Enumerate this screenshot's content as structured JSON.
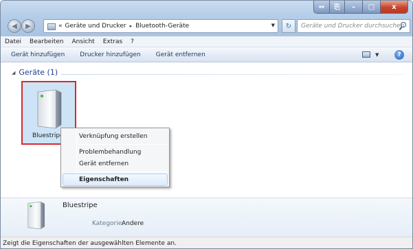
{
  "window": {
    "buttons": {
      "extra_1": "↔",
      "extra_2": "⎘",
      "minimize": "–",
      "maximize": "□",
      "close": "x"
    }
  },
  "nav": {
    "back_glyph": "◀",
    "forward_glyph": "▶",
    "recent_glyph": "▼",
    "address_prefix": "«",
    "breadcrumbs": [
      "Geräte und Drucker",
      "Bluetooth-Geräte"
    ],
    "breadcrumb_separator": "▸",
    "address_drop_glyph": "▼",
    "refresh_glyph": "↻",
    "search_placeholder": "Geräte und Drucker durchsuchen"
  },
  "menubar": {
    "items": [
      "Datei",
      "Bearbeiten",
      "Ansicht",
      "Extras",
      "?"
    ]
  },
  "commandbar": {
    "items": [
      "Gerät hinzufügen",
      "Drucker hinzufügen",
      "Gerät entfernen"
    ],
    "view_drop_glyph": "▼",
    "help_glyph": "?"
  },
  "content": {
    "group_toggle_glyph": "◢",
    "group_label": "Geräte (1)",
    "device": {
      "name": "Bluestripe"
    }
  },
  "context_menu": {
    "items": [
      {
        "label": "Verknüpfung erstellen"
      },
      {
        "label": "Problembehandlung"
      },
      {
        "label": "Gerät entfernen"
      },
      {
        "label": "Eigenschaften",
        "bold": true,
        "highlighted": true
      }
    ]
  },
  "details": {
    "name": "Bluestripe",
    "category_label": "Kategorie:",
    "category_value": "Andere"
  },
  "statusbar": {
    "text": "Zeigt die Eigenschaften der ausgewählten Elemente an."
  },
  "colors": {
    "accent_link": "#1e3f8a",
    "selection_border": "#d7282e",
    "selection_fill": "#cde4f7",
    "close_button": "#c8442c"
  }
}
